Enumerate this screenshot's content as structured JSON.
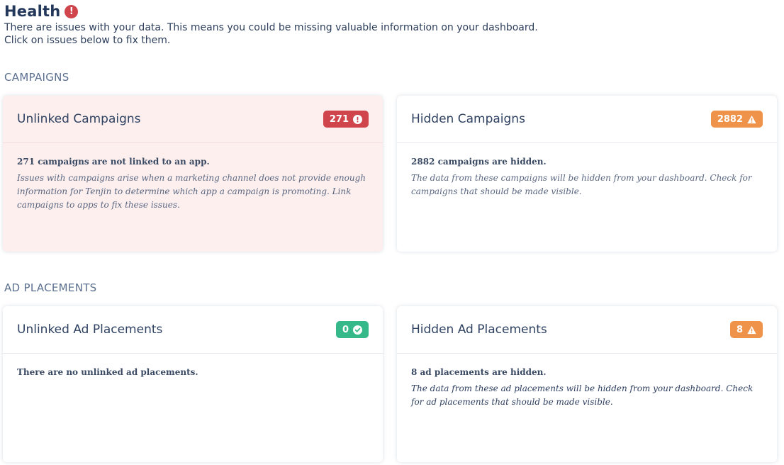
{
  "header": {
    "title": "Health",
    "subtitle_line1": "There are issues with your data. This means you could be missing valuable information on your dashboard.",
    "subtitle_line2": "Click on issues below to fix them."
  },
  "sections": {
    "campaigns": "CAMPAIGNS",
    "ad_placements": "AD PLACEMENTS"
  },
  "cards": {
    "unlinked_campaigns": {
      "title": "Unlinked Campaigns",
      "count": "271",
      "status": "error",
      "summary": "271 campaigns are not linked to an app.",
      "detail": "Issues with campaigns arise when a marketing channel does not provide enough information for Tenjin to determine which app a campaign is promoting. Link campaigns to apps to fix these issues."
    },
    "hidden_campaigns": {
      "title": "Hidden Campaigns",
      "count": "2882",
      "status": "warning",
      "summary": "2882 campaigns are hidden.",
      "detail": "The data from these campaigns will be hidden from your dashboard. Check for campaigns that should be made visible."
    },
    "unlinked_ad_placements": {
      "title": "Unlinked Ad Placements",
      "count": "0",
      "status": "ok",
      "summary": "There are no unlinked ad placements."
    },
    "hidden_ad_placements": {
      "title": "Hidden Ad Placements",
      "count": "8",
      "status": "warning",
      "summary": "8 ad placements are hidden.",
      "detail": "The data from these ad placements will be hidden from your dashboard. Check for ad placements that should be made visible."
    }
  },
  "colors": {
    "error": "#d0454c",
    "warning": "#f0934a",
    "ok": "#35b88a",
    "error_card_bg": "#fcefee"
  }
}
